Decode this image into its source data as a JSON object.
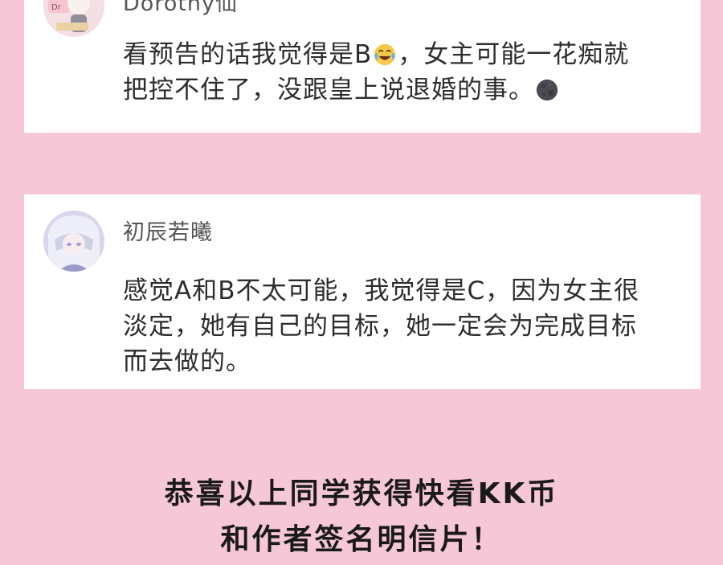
{
  "comments": [
    {
      "username": "Dorothy仙",
      "lines": [
        "看预告的话我觉得是B",
        "，女主可能一花痴就",
        "把控不住了，没跟皇上说退婚的事。"
      ],
      "emojis": [
        "tears-of-joy-emoji",
        "new-moon-face-emoji"
      ]
    },
    {
      "username": "初辰若曦",
      "lines": [
        "感觉A和B不太可能，我觉得是C，因为女主很",
        "淡定，她有自己的目标，她一定会为完成目标",
        "而去做的。"
      ]
    }
  ],
  "congrats": {
    "line1": "恭喜以上同学获得快看KK币",
    "line2": "和作者签名明信片！"
  },
  "colors": {
    "background": "#f6c7d6",
    "card": "#ffffff"
  }
}
